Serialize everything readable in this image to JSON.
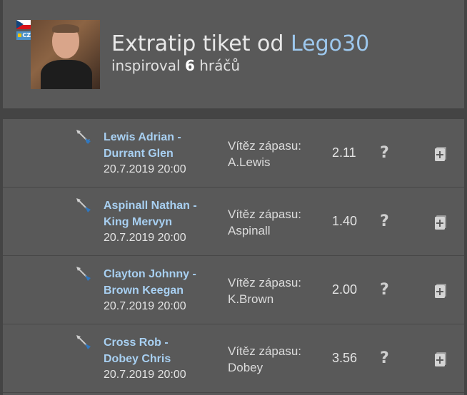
{
  "header": {
    "flag_badge": "CZ",
    "title_prefix": "Extratip tiket od",
    "username": "Lego30",
    "subtitle_prefix": "inspiroval",
    "count": "6",
    "subtitle_suffix": "hráčů"
  },
  "rows": [
    {
      "match_line1": "Lewis Adrian -",
      "match_line2": "Durrant Glen",
      "date": "20.7.2019 20:00",
      "tip_label": "Vítěz zápasu:",
      "tip_value": "A.Lewis",
      "odds": "2.11"
    },
    {
      "match_line1": "Aspinall Nathan -",
      "match_line2": "King Mervyn",
      "date": "20.7.2019 20:00",
      "tip_label": "Vítěz zápasu:",
      "tip_value": "Aspinall",
      "odds": "1.40"
    },
    {
      "match_line1": "Clayton Johnny -",
      "match_line2": "Brown Keegan",
      "date": "20.7.2019 20:00",
      "tip_label": "Vítěz zápasu:",
      "tip_value": "K.Brown",
      "odds": "2.00"
    },
    {
      "match_line1": "Cross Rob -",
      "match_line2": "Dobey Chris",
      "date": "20.7.2019 20:00",
      "tip_label": "Vítěz zápasu:",
      "tip_value": "Dobey",
      "odds": "3.56"
    }
  ],
  "icons": {
    "sport": "darts-icon",
    "info": "question-mark-icon",
    "add": "add-to-ticket-icon"
  },
  "colors": {
    "background": "#444444",
    "panel": "#595959",
    "link": "#a8d0f2",
    "username": "#9dc8ee"
  }
}
